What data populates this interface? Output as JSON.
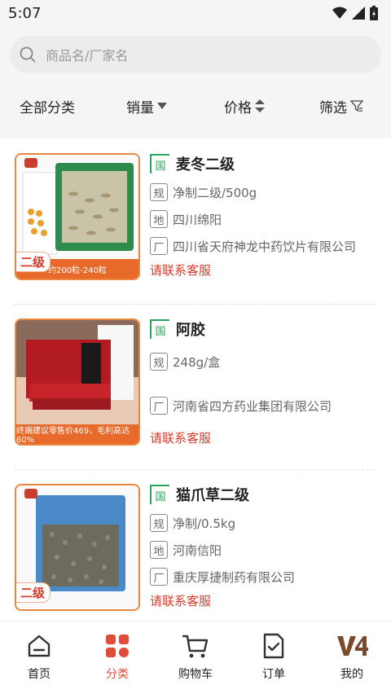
{
  "status": {
    "time": "5:07"
  },
  "search": {
    "placeholder": "商品名/厂家名"
  },
  "filters": [
    {
      "label": "全部分类"
    },
    {
      "label": "销量"
    },
    {
      "label": "价格"
    },
    {
      "label": "筛选"
    }
  ],
  "products": [
    {
      "badge": "国",
      "title": "麦冬二级",
      "attrs": [
        {
          "icon": "规",
          "text": "净制二级/500g"
        },
        {
          "icon": "地",
          "text": "四川绵阳"
        },
        {
          "icon": "厂",
          "text": "四川省天府神龙中药饮片有限公司"
        }
      ],
      "contact": "请联系客服",
      "thumb_bottom": "约200粒-240粒",
      "grade": "二级"
    },
    {
      "badge": "国",
      "title": "阿胶",
      "attrs": [
        {
          "icon": "规",
          "text": "248g/盒"
        },
        {
          "icon": "厂",
          "text": "河南省四方药业集团有限公司"
        }
      ],
      "contact": "请联系客服",
      "thumb_bottom": "终端建议零售价469，毛利高达60%"
    },
    {
      "badge": "国",
      "title": "猫爪草二级",
      "attrs": [
        {
          "icon": "规",
          "text": "净制/0.5kg"
        },
        {
          "icon": "地",
          "text": "河南信阳"
        },
        {
          "icon": "厂",
          "text": "重庆厚捷制药有限公司"
        }
      ],
      "contact": "请联系客服",
      "grade": "二级"
    }
  ],
  "tabs": [
    {
      "label": "首页",
      "icon": "home-icon"
    },
    {
      "label": "分类",
      "icon": "category-icon",
      "active": true
    },
    {
      "label": "购物车",
      "icon": "cart-icon"
    },
    {
      "label": "订单",
      "icon": "order-icon"
    },
    {
      "label": "我的",
      "icon": "profile-icon"
    }
  ],
  "colors": {
    "accent": "#e04b3a",
    "green": "#2aa55b",
    "orange": "#e8873d"
  }
}
